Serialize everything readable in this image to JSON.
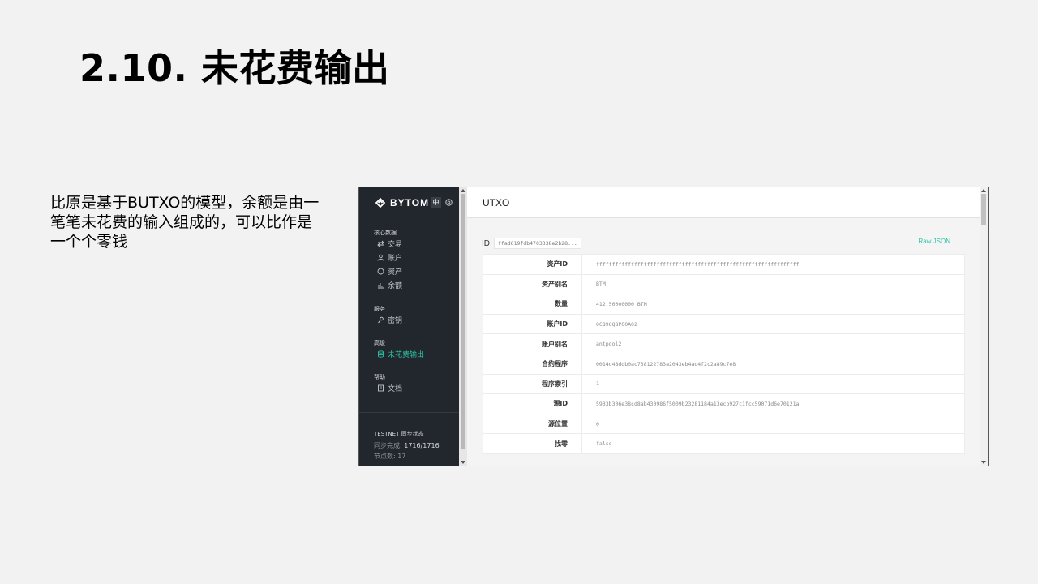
{
  "slide": {
    "title": "2.10. 未花费输出",
    "description": "比原是基于BUTXO的模型，余额是由一笔笔未花费的输入组成的，可以比作是一个个零钱"
  },
  "app": {
    "brand": "BYTOM",
    "lang_label": "中",
    "nav": {
      "core_section": "核心数据",
      "transactions": "交易",
      "accounts": "账户",
      "assets": "资产",
      "balances": "余额",
      "services_section": "服务",
      "keys": "密钥",
      "advanced_section": "高级",
      "utxo": "未花费输出",
      "help_section": "帮助",
      "docs": "文档"
    },
    "status": {
      "network": "TESTNET 同步状态",
      "sync_label": "同步完成: ",
      "sync_value": "1716/1716",
      "peers": "节点数: 17"
    },
    "accent_color": "#2ec4a5"
  },
  "main": {
    "title": "UTXO",
    "id_label": "ID",
    "id_value": "ffad619fdb4703338e2b28...",
    "raw_json": "Raw JSON",
    "rows": [
      {
        "key": "资产ID",
        "value": "ffffffffffffffffffffffffffffffffffffffffffffffffffffffffffffffff"
      },
      {
        "key": "资产别名",
        "value": "BTM"
      },
      {
        "key": "数量",
        "value": "412.50000000 BTM"
      },
      {
        "key": "账户ID",
        "value": "0C896Q8P00A02"
      },
      {
        "key": "账户别名",
        "value": "antpool2"
      },
      {
        "key": "合约程序",
        "value": "0014d48ddb0ac738122783a2043eb4ad4f2c2a89c7e8"
      },
      {
        "key": "程序索引",
        "value": "1"
      },
      {
        "key": "源ID",
        "value": "5933b306e38cd8ab430986f5009b23281184a13ecb927c1fcc59071d6e70121a"
      },
      {
        "key": "源位置",
        "value": "0"
      },
      {
        "key": "找零",
        "value": "false"
      }
    ]
  }
}
